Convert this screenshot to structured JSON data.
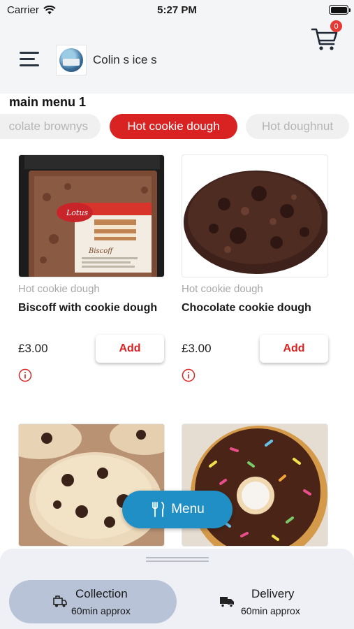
{
  "status_bar": {
    "carrier": "Carrier",
    "time": "5:27 PM"
  },
  "header": {
    "shop_name": "Colin s ice s",
    "cart_count": "0"
  },
  "menu_title": "main menu 1",
  "categories": [
    {
      "label": "colate brownys",
      "active": false
    },
    {
      "label": "Hot cookie dough",
      "active": true
    },
    {
      "label": "Hot doughnut",
      "active": false
    }
  ],
  "products": [
    {
      "category": "Hot cookie dough",
      "name": "Biscoff with cookie dough",
      "price": "£3.00",
      "add_label": "Add",
      "image": "lotus-biscoff-tray"
    },
    {
      "category": "Hot cookie dough",
      "name": "Chocolate cookie dough",
      "price": "£3.00",
      "add_label": "Add",
      "image": "chocolate-cookie"
    },
    {
      "image": "chocolate-chip-cookies"
    },
    {
      "image": "sprinkle-doughnut"
    }
  ],
  "menu_button": {
    "label": "Menu"
  },
  "order_options": {
    "collection": {
      "title": "Collection",
      "subtitle": "60min approx",
      "selected": true
    },
    "delivery": {
      "title": "Delivery",
      "subtitle": "60min approx",
      "selected": false
    }
  },
  "colors": {
    "accent_red": "#d92323",
    "menu_blue": "#1f8fc6",
    "selected_option": "#b8c3d8"
  }
}
